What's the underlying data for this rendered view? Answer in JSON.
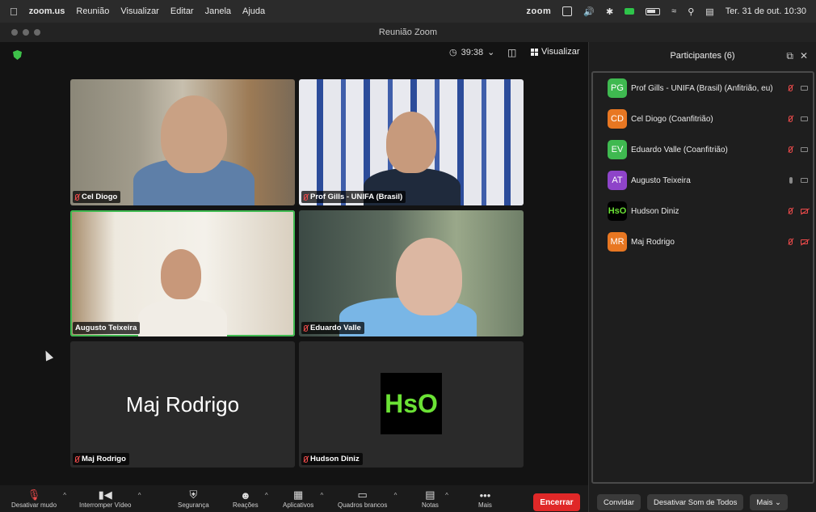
{
  "menubar": {
    "app": "zoom.us",
    "items": [
      "Reunião",
      "Visualizar",
      "Editar",
      "Janela",
      "Ajuda"
    ],
    "brand": "zoom",
    "datetime": "Ter. 31 de out.  10:30"
  },
  "window": {
    "title": "Reunião Zoom"
  },
  "meeting": {
    "timer": "39:38",
    "view_label": "Visualizar"
  },
  "tiles": [
    {
      "name": "Cel Diogo",
      "muted": true
    },
    {
      "name": "Prof Gills - UNIFA (Brasil)",
      "muted": true
    },
    {
      "name": "Augusto Teixeira",
      "muted": false
    },
    {
      "name": "Eduardo Valle",
      "muted": true
    },
    {
      "name": "Maj Rodrigo",
      "muted": true,
      "display": "Maj Rodrigo"
    },
    {
      "name": "Hudson Diniz",
      "muted": true,
      "logo": "HsO"
    }
  ],
  "toolbar": {
    "buttons": [
      {
        "label": "Desativar mudo",
        "icon": "mic-muted-icon"
      },
      {
        "label": "Interromper Vídeo",
        "icon": "video-icon"
      },
      {
        "label": "Segurança",
        "icon": "shield-icon"
      },
      {
        "label": "Reações",
        "icon": "emoji-icon"
      },
      {
        "label": "Aplicativos",
        "icon": "apps-icon"
      },
      {
        "label": "Quadros brancos",
        "icon": "whiteboard-icon"
      },
      {
        "label": "Notas",
        "icon": "notes-icon"
      },
      {
        "label": "Mais",
        "icon": "more-icon"
      }
    ],
    "end_label": "Encerrar"
  },
  "participants": {
    "title": "Participantes (6)",
    "list": [
      {
        "initials": "PG",
        "name": "Prof Gills - UNIFA (Brasil) (Anfitrião, eu)",
        "color": "#3fb950"
      },
      {
        "initials": "CD",
        "name": "Cel Diogo (Coanfitrião)",
        "color": "#e87722"
      },
      {
        "initials": "EV",
        "name": "Eduardo Valle (Coanfitrião)",
        "color": "#3fb950"
      },
      {
        "initials": "AT",
        "name": "Augusto Teixeira",
        "color": "#8e44c9"
      },
      {
        "initials": "HsO",
        "name": "Hudson Diniz",
        "color": "#000000"
      },
      {
        "initials": "MR",
        "name": "Maj Rodrigo",
        "color": "#e87722"
      }
    ],
    "invite_label": "Convidar",
    "mute_all_label": "Desativar Som de Todos",
    "more_label": "Mais"
  }
}
